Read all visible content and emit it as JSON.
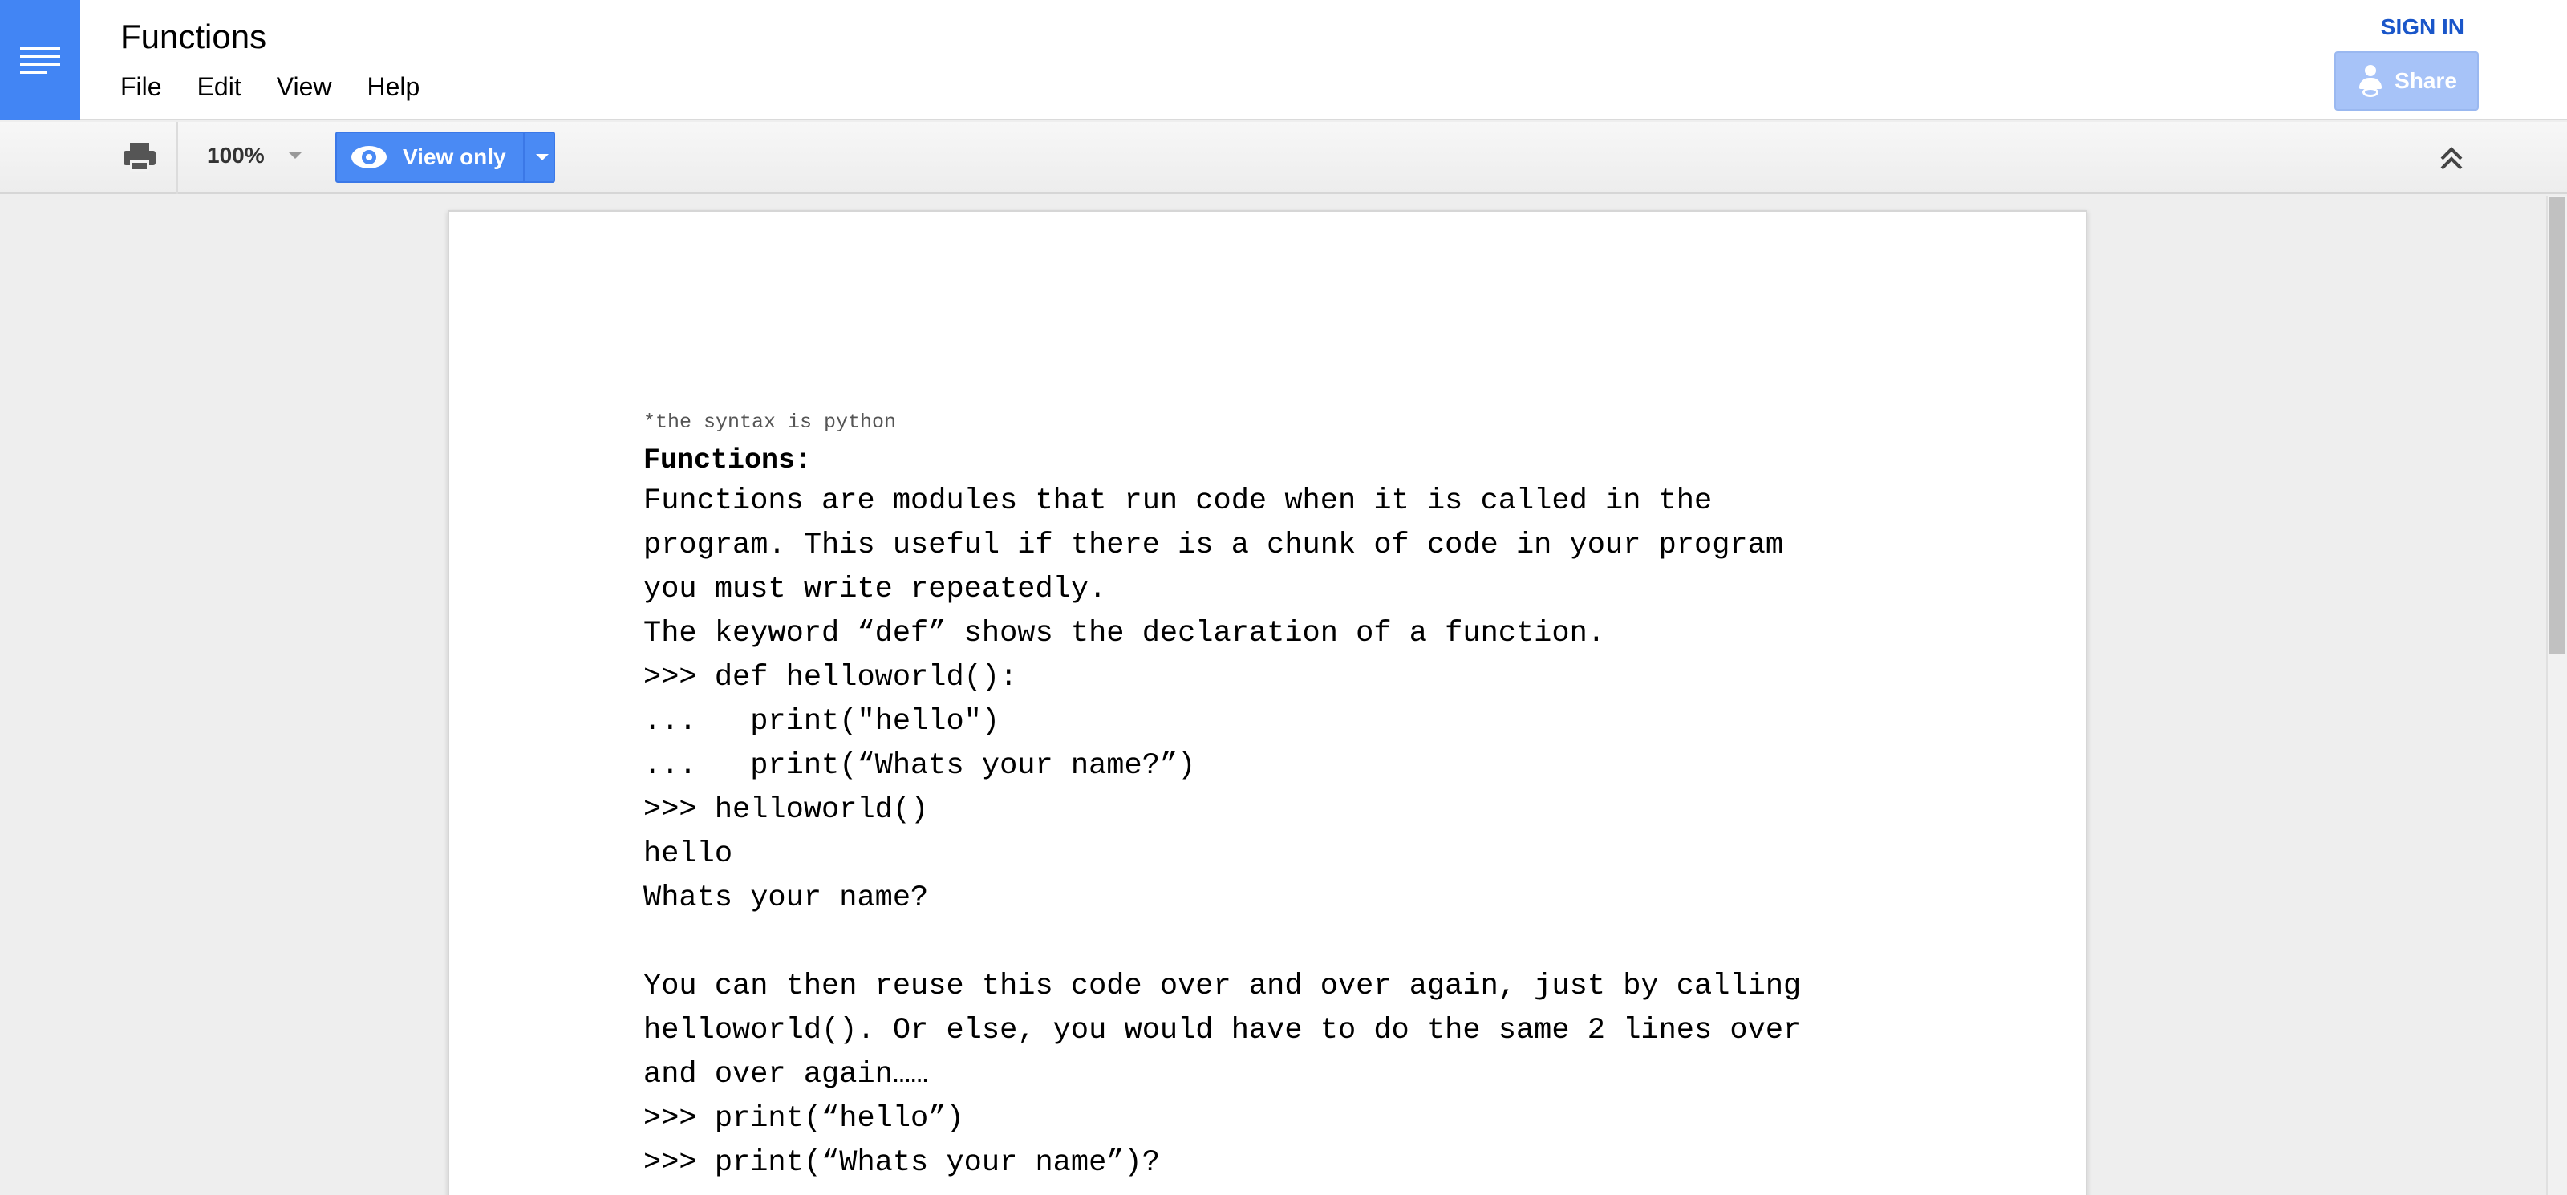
{
  "app": {
    "title": "Functions",
    "brand_color": "#4285f4",
    "logo_icon": "docs-menu-icon"
  },
  "menu": {
    "items": [
      {
        "label": "File"
      },
      {
        "label": "Edit"
      },
      {
        "label": "View"
      },
      {
        "label": "Help"
      }
    ]
  },
  "account": {
    "sign_in_label": "SIGN IN",
    "share_label": "Share",
    "share_icon": "share-person-icon"
  },
  "toolbar": {
    "print_icon": "print-icon",
    "zoom": "100%",
    "mode_label": "View only",
    "mode_icon": "eye-icon",
    "collapse_icon": "double-chevron-up-icon",
    "accent_color": "#4a8af4"
  },
  "document": {
    "note": "*the syntax is python",
    "heading": "Functions:",
    "lines": [
      "Functions are modules that run code when it is called in the",
      "program. This useful if there is a chunk of code in your program",
      "you must write repeatedly.",
      "The keyword “def” shows the declaration of a function.",
      ">>> def helloworld():",
      "...   print(\"hello\")",
      "...   print(“Whats your name?”)",
      ">>> helloworld()",
      "hello",
      "Whats your name?",
      "",
      "You can then reuse this code over and over again, just by calling",
      "helloworld(). Or else, you would have to do the same 2 lines over",
      "and over again……",
      ">>> print(“hello”)",
      ">>> print(“Whats your name”)?"
    ]
  }
}
